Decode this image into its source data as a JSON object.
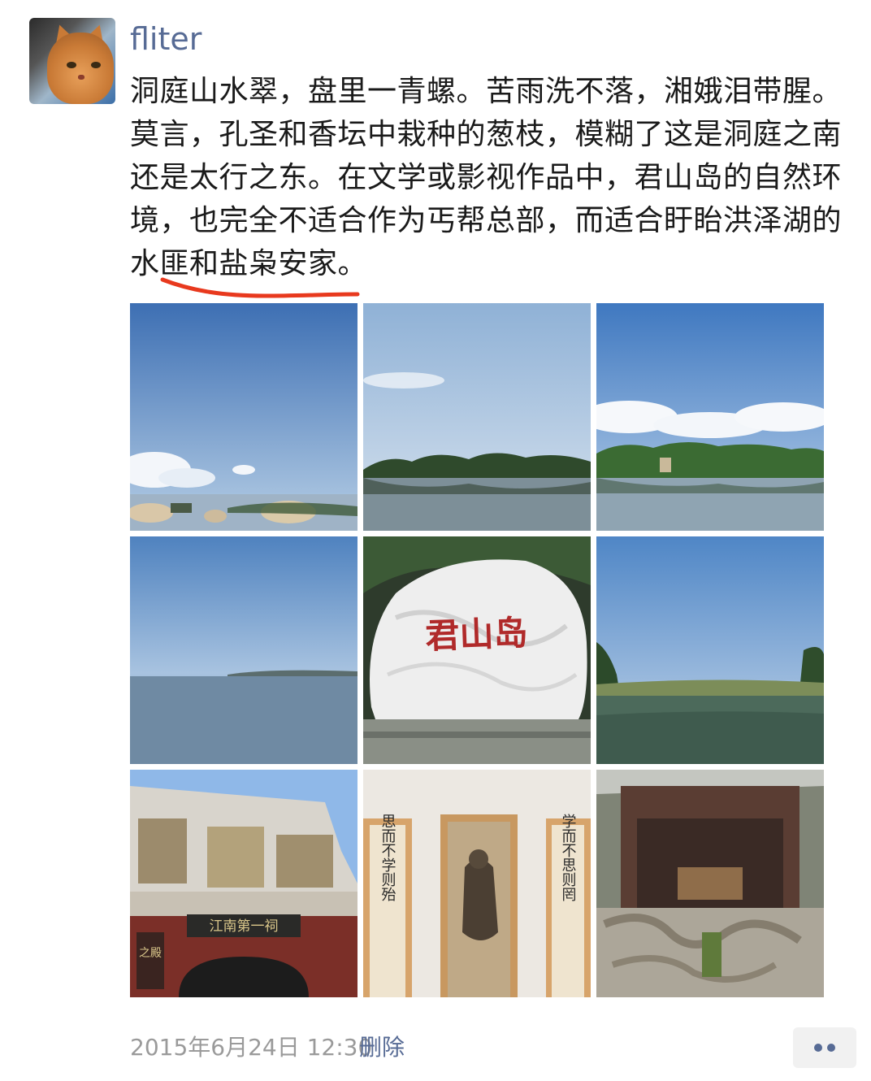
{
  "post": {
    "username": "fliter",
    "text": "洞庭山水翠，盘里一青螺。苦雨洗不落，湘娥泪带腥。莫言，孔圣和香坛中栽种的葱枝，模糊了这是洞庭之南还是太行之东。在文学或影视作品中，君山岛的自然环境，也完全不适合作为丐帮总部，而适合盱眙洪泽湖的水匪和盐枭安家。",
    "timestamp": "2015年6月24日 12:30",
    "delete_label": "删除"
  },
  "photos": {
    "stone_inscription": "君山岛",
    "gate_plaque": "江南第一祠",
    "left_scroll": "思而不学则殆",
    "right_scroll": "学而不思则罔",
    "side_plaque": "之殿"
  },
  "colors": {
    "link": "#576b95",
    "underline": "#e8391e"
  },
  "icons": {
    "more": "more-dots-icon"
  }
}
